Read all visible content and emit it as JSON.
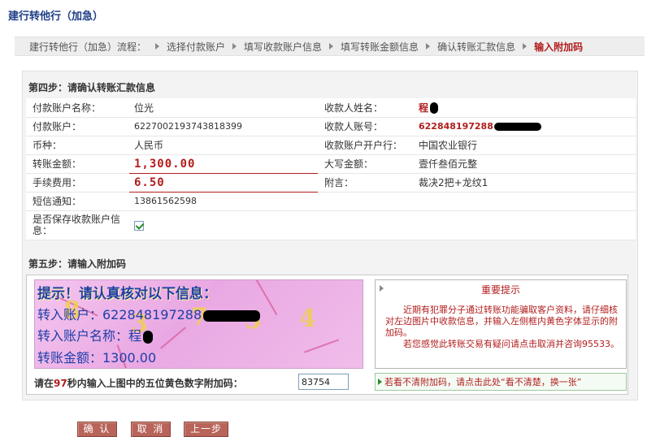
{
  "page_title": "建行转他行（加急）",
  "steps": {
    "prefix": "建行转他行（加急）流程：",
    "items": [
      "选择付款账户",
      "填写收款账户信息",
      "填写转账金额信息",
      "确认转账汇款信息",
      "输入附加码"
    ],
    "active_index": 4
  },
  "step4": {
    "title": "第四步：请确认转账汇款信息",
    "rows": [
      {
        "l1": "付款账户名称：",
        "v1": "位光",
        "l2": "收款人姓名：",
        "v2": "程"
      },
      {
        "l1": "付款账户：",
        "v1": "6227002193743818399",
        "l2": "收款人账号：",
        "v2": "622848197288"
      },
      {
        "l1": "币种：",
        "v1": "人民币",
        "l2": "收款账户开户行：",
        "v2": "中国农业银行"
      },
      {
        "l1": "转账金额：",
        "v1": "1,300.00",
        "l2": "大写金额：",
        "v2": "壹仟叁佰元整"
      },
      {
        "l1": "手续费用：",
        "v1": "6.50",
        "l2": "附言：",
        "v2": "裁决2把+龙纹1"
      },
      {
        "l1": "短信通知：",
        "v1": "13861562598"
      },
      {
        "l1": "是否保存收款账户信息：",
        "checked": true
      }
    ]
  },
  "step5": {
    "title": "第五步：请输入附加码",
    "captcha": {
      "headline": "提示！请认真核对以下信息：",
      "line1": "转入账户：622848197288",
      "line2": "转入账户名称：程",
      "line3": "转账金额：1300.00",
      "digits": [
        "8",
        "3",
        "7",
        "5",
        "4"
      ]
    },
    "notice": {
      "title": "重要提示",
      "para1": "近期有犯罪分子通过转账功能骗取客户资料，请仔细核对左边图片中收款信息，并输入左侧框内黄色字体显示的附加码。",
      "para2": "若您感觉此转账交易有疑问请点击取消并咨询95533。"
    },
    "input_label_pre": "请在",
    "input_label_seconds": "97",
    "input_label_post": "秒内输入上图中的五位黄色数字附加码：",
    "input_value": "83754",
    "refresh_pre": "若看不清附加码，请点击此处",
    "refresh_link": "“看不清楚，换一张”"
  },
  "buttons": {
    "confirm": "确 认",
    "cancel": "取 消",
    "prev": "上一步"
  },
  "colors": {
    "accent_red": "#b21d1d",
    "title_blue": "#1f3f86",
    "button_bg": "#b8645a"
  }
}
